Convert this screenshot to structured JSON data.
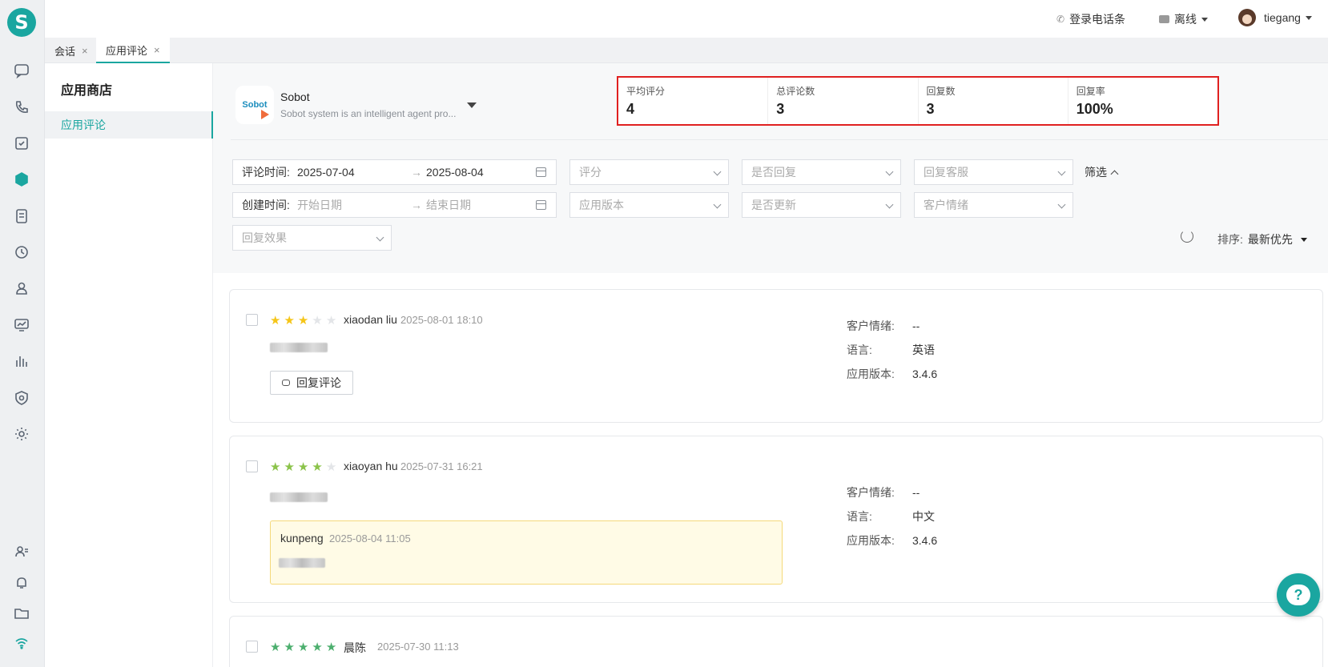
{
  "brand": {
    "logo_letter": "S",
    "accent": "#1aa6a0"
  },
  "rail": {
    "items": [
      "chat-icon",
      "phone-icon",
      "task-icon",
      "app-review-icon",
      "document-icon",
      "history-icon",
      "customer-icon",
      "monitor-icon",
      "report-icon",
      "security-icon",
      "settings-icon"
    ],
    "bottom": [
      "agent-status-icon",
      "bell-icon",
      "folder-icon",
      "wifi-icon"
    ]
  },
  "topbar": {
    "phone_login": "登录电话条",
    "status": "离线",
    "username": "tiegang"
  },
  "tabs": [
    {
      "label": "会话",
      "close": "×"
    },
    {
      "label": "应用评论",
      "close": "×"
    }
  ],
  "sidebar": {
    "title": "应用商店",
    "items": [
      {
        "label": "应用评论"
      }
    ]
  },
  "app": {
    "logo_text": "Sobot",
    "name": "Sobot",
    "desc": "Sobot system is an intelligent agent pro..."
  },
  "stats": [
    {
      "label": "平均评分",
      "value": "4"
    },
    {
      "label": "总评论数",
      "value": "3"
    },
    {
      "label": "回复数",
      "value": "3"
    },
    {
      "label": "回复率",
      "value": "100%"
    }
  ],
  "filters": {
    "review_time_label": "评论时间:",
    "review_start": "2025-07-04",
    "review_end": "2025-08-04",
    "arrow": "→",
    "create_time_label": "创建时间:",
    "create_start_ph": "开始日期",
    "create_end_ph": "结束日期",
    "rating_ph": "评分",
    "replied_ph": "是否回复",
    "reply_agent_ph": "回复客服",
    "app_version_ph": "应用版本",
    "updated_ph": "是否更新",
    "sentiment_ph": "客户情绪",
    "reply_effect_ph": "回复效果",
    "toggle_label": "筛选",
    "sort_label": "排序:",
    "sort_value": "最新优先"
  },
  "reviews": [
    {
      "rating": 3,
      "star_color": "#f5c518",
      "user": "xiaodan liu",
      "time": "2025-08-01 18:10",
      "reply_button": "回复评论",
      "sentiment_label": "客户情绪:",
      "sentiment": "--",
      "language_label": "语言:",
      "language": "英语",
      "version_label": "应用版本:",
      "version": "3.4.6"
    },
    {
      "rating": 4,
      "star_color": "#8bc34a",
      "user": "xiaoyan hu",
      "time": "2025-07-31 16:21",
      "reply_user": "kunpeng",
      "reply_time": "2025-08-04 11:05",
      "sentiment_label": "客户情绪:",
      "sentiment": "--",
      "language_label": "语言:",
      "language": "中文",
      "version_label": "应用版本:",
      "version": "3.4.6"
    },
    {
      "rating": 5,
      "star_color": "#4caf6e",
      "user": "晨陈",
      "time": "2025-07-30 11:13"
    }
  ],
  "help": {
    "glyph": "?"
  }
}
